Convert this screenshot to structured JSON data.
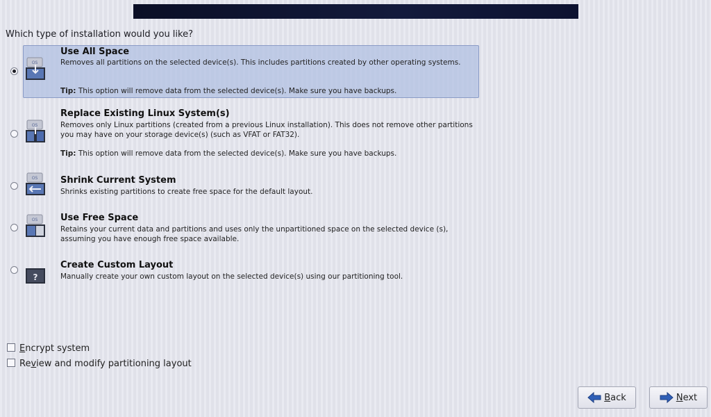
{
  "question": "Which type of installation would you like?",
  "options": [
    {
      "title": "Use All Space",
      "desc": "Removes all partitions on the selected device(s).  This includes partitions created by other operating systems.",
      "tip_label": "Tip:",
      "tip_text": " This option will remove data from the selected device(s).  Make sure you have backups.",
      "selected": true,
      "icon": "drive-full-icon"
    },
    {
      "title": "Replace Existing Linux System(s)",
      "desc": "Removes only Linux partitions (created from a previous Linux installation).  This does not remove other partitions you may have on your storage device(s) (such as VFAT or FAT32).",
      "tip_label": "Tip:",
      "tip_text": " This option will remove data from the selected device(s).  Make sure you have backups.",
      "selected": false,
      "icon": "drive-replace-icon"
    },
    {
      "title": "Shrink Current System",
      "desc": "Shrinks existing partitions to create free space for the default layout.",
      "selected": false,
      "icon": "drive-shrink-icon"
    },
    {
      "title": "Use Free Space",
      "desc": "Retains your current data and partitions and uses only the unpartitioned space on the selected device (s), assuming you have enough free space available.",
      "selected": false,
      "icon": "drive-free-space-icon"
    },
    {
      "title": "Create Custom Layout",
      "desc": "Manually create your own custom layout on the selected device(s) using our partitioning tool.",
      "selected": false,
      "icon": "custom-layout-icon"
    }
  ],
  "icon_label": "OS",
  "custom_icon_label": "?",
  "checkboxes": {
    "encrypt": {
      "mnemonic": "E",
      "rest": "ncrypt system",
      "checked": false
    },
    "review": {
      "before": "Re",
      "mnemonic": "v",
      "rest": "iew and modify partitioning layout",
      "checked": false
    }
  },
  "buttons": {
    "back": {
      "mnemonic": "B",
      "rest": "ack"
    },
    "next": {
      "mnemonic": "N",
      "rest": "ext"
    }
  },
  "colors": {
    "selection": "#b2c0e2",
    "banner": "#0b0f26",
    "arrow": "#2f5fb7"
  }
}
